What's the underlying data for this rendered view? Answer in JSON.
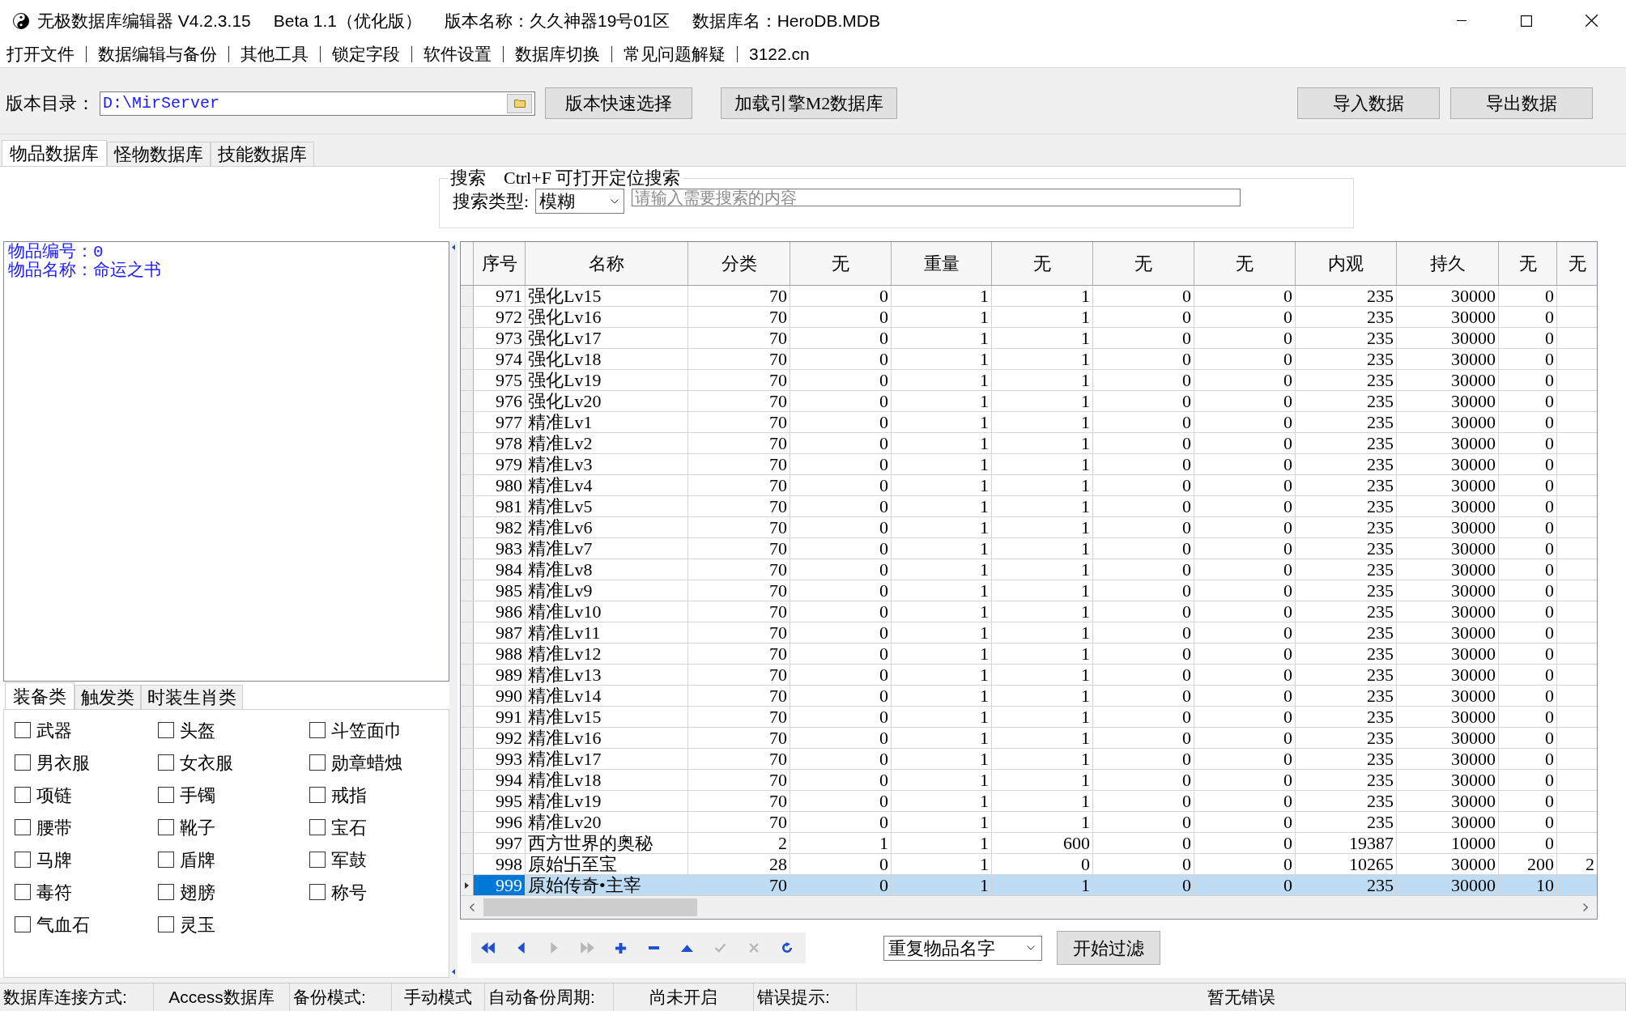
{
  "title_bar": {
    "texts": [
      "无极数据库编辑器 V4.2.3.15",
      "Beta 1.1（优化版）",
      "版本名称：久久神器19号01区",
      "数据库名：HeroDB.MDB"
    ]
  },
  "menu": [
    "打开文件",
    "数据编辑与备份",
    "其他工具",
    "锁定字段",
    "软件设置",
    "数据库切换",
    "常见问题解疑",
    "3122.cn"
  ],
  "toolbar": {
    "directory_label": "版本目录：",
    "directory_field": {
      "value": "D:\\MirServer"
    },
    "buttons": [
      "版本快速选择",
      "加载引擎M2数据库"
    ],
    "right_buttons": [
      "导入数据",
      "导出数据"
    ]
  },
  "tabs": [
    {
      "label": "物品数据库",
      "selected": true
    },
    {
      "label": "怪物数据库",
      "selected": false
    },
    {
      "label": "技能数据库",
      "selected": false
    }
  ],
  "search": {
    "title": "搜索",
    "hint": "Ctrl+F 可打开定位搜索",
    "type_label": "搜索类型:",
    "type_value": "模糊",
    "placeholder": "请输入需要搜索的内容"
  },
  "item_info": {
    "lines": [
      "物品编号：0",
      "物品名称：命运之书"
    ]
  },
  "category_tabs": [
    {
      "label": "装备类",
      "selected": true
    },
    {
      "label": "触发类",
      "selected": false
    },
    {
      "label": "时装生肖类",
      "selected": false
    }
  ],
  "categories": [
    {
      "label": "武器",
      "checked": false
    },
    {
      "label": "头盔",
      "checked": false
    },
    {
      "label": "斗笠面巾",
      "checked": false
    },
    {
      "label": "男衣服",
      "checked": false
    },
    {
      "label": "女衣服",
      "checked": false
    },
    {
      "label": "勋章蜡烛",
      "checked": false
    },
    {
      "label": "项链",
      "checked": false
    },
    {
      "label": "手镯",
      "checked": false
    },
    {
      "label": "戒指",
      "checked": false
    },
    {
      "label": "腰带",
      "checked": false
    },
    {
      "label": "靴子",
      "checked": false
    },
    {
      "label": "宝石",
      "checked": false
    },
    {
      "label": "马牌",
      "checked": false
    },
    {
      "label": "盾牌",
      "checked": false
    },
    {
      "label": "军鼓",
      "checked": false
    },
    {
      "label": "毒符",
      "checked": false
    },
    {
      "label": "翅膀",
      "checked": false
    },
    {
      "label": "称号",
      "checked": false
    },
    {
      "label": "气血石",
      "checked": false
    },
    {
      "label": "灵玉",
      "checked": false
    }
  ],
  "table": {
    "columns": [
      "序号",
      "名称",
      "分类",
      "无",
      "重量",
      "无",
      "无",
      "无",
      "内观",
      "持久",
      "无",
      "无"
    ],
    "rows": [
      {
        "cells": [
          "971",
          "强化Lv15",
          "70",
          "0",
          "1",
          "1",
          "0",
          "0",
          "235",
          "30000",
          "0"
        ],
        "selected": false
      },
      {
        "cells": [
          "972",
          "强化Lv16",
          "70",
          "0",
          "1",
          "1",
          "0",
          "0",
          "235",
          "30000",
          "0"
        ],
        "selected": false
      },
      {
        "cells": [
          "973",
          "强化Lv17",
          "70",
          "0",
          "1",
          "1",
          "0",
          "0",
          "235",
          "30000",
          "0"
        ],
        "selected": false
      },
      {
        "cells": [
          "974",
          "强化Lv18",
          "70",
          "0",
          "1",
          "1",
          "0",
          "0",
          "235",
          "30000",
          "0"
        ],
        "selected": false
      },
      {
        "cells": [
          "975",
          "强化Lv19",
          "70",
          "0",
          "1",
          "1",
          "0",
          "0",
          "235",
          "30000",
          "0"
        ],
        "selected": false
      },
      {
        "cells": [
          "976",
          "强化Lv20",
          "70",
          "0",
          "1",
          "1",
          "0",
          "0",
          "235",
          "30000",
          "0"
        ],
        "selected": false
      },
      {
        "cells": [
          "977",
          "精准Lv1",
          "70",
          "0",
          "1",
          "1",
          "0",
          "0",
          "235",
          "30000",
          "0"
        ],
        "selected": false
      },
      {
        "cells": [
          "978",
          "精准Lv2",
          "70",
          "0",
          "1",
          "1",
          "0",
          "0",
          "235",
          "30000",
          "0"
        ],
        "selected": false
      },
      {
        "cells": [
          "979",
          "精准Lv3",
          "70",
          "0",
          "1",
          "1",
          "0",
          "0",
          "235",
          "30000",
          "0"
        ],
        "selected": false
      },
      {
        "cells": [
          "980",
          "精准Lv4",
          "70",
          "0",
          "1",
          "1",
          "0",
          "0",
          "235",
          "30000",
          "0"
        ],
        "selected": false
      },
      {
        "cells": [
          "981",
          "精准Lv5",
          "70",
          "0",
          "1",
          "1",
          "0",
          "0",
          "235",
          "30000",
          "0"
        ],
        "selected": false
      },
      {
        "cells": [
          "982",
          "精准Lv6",
          "70",
          "0",
          "1",
          "1",
          "0",
          "0",
          "235",
          "30000",
          "0"
        ],
        "selected": false
      },
      {
        "cells": [
          "983",
          "精准Lv7",
          "70",
          "0",
          "1",
          "1",
          "0",
          "0",
          "235",
          "30000",
          "0"
        ],
        "selected": false
      },
      {
        "cells": [
          "984",
          "精准Lv8",
          "70",
          "0",
          "1",
          "1",
          "0",
          "0",
          "235",
          "30000",
          "0"
        ],
        "selected": false
      },
      {
        "cells": [
          "985",
          "精准Lv9",
          "70",
          "0",
          "1",
          "1",
          "0",
          "0",
          "235",
          "30000",
          "0"
        ],
        "selected": false
      },
      {
        "cells": [
          "986",
          "精准Lv10",
          "70",
          "0",
          "1",
          "1",
          "0",
          "0",
          "235",
          "30000",
          "0"
        ],
        "selected": false
      },
      {
        "cells": [
          "987",
          "精准Lv11",
          "70",
          "0",
          "1",
          "1",
          "0",
          "0",
          "235",
          "30000",
          "0"
        ],
        "selected": false
      },
      {
        "cells": [
          "988",
          "精准Lv12",
          "70",
          "0",
          "1",
          "1",
          "0",
          "0",
          "235",
          "30000",
          "0"
        ],
        "selected": false
      },
      {
        "cells": [
          "989",
          "精准Lv13",
          "70",
          "0",
          "1",
          "1",
          "0",
          "0",
          "235",
          "30000",
          "0"
        ],
        "selected": false
      },
      {
        "cells": [
          "990",
          "精准Lv14",
          "70",
          "0",
          "1",
          "1",
          "0",
          "0",
          "235",
          "30000",
          "0"
        ],
        "selected": false
      },
      {
        "cells": [
          "991",
          "精准Lv15",
          "70",
          "0",
          "1",
          "1",
          "0",
          "0",
          "235",
          "30000",
          "0"
        ],
        "selected": false
      },
      {
        "cells": [
          "992",
          "精准Lv16",
          "70",
          "0",
          "1",
          "1",
          "0",
          "0",
          "235",
          "30000",
          "0"
        ],
        "selected": false
      },
      {
        "cells": [
          "993",
          "精准Lv17",
          "70",
          "0",
          "1",
          "1",
          "0",
          "0",
          "235",
          "30000",
          "0"
        ],
        "selected": false
      },
      {
        "cells": [
          "994",
          "精准Lv18",
          "70",
          "0",
          "1",
          "1",
          "0",
          "0",
          "235",
          "30000",
          "0"
        ],
        "selected": false
      },
      {
        "cells": [
          "995",
          "精准Lv19",
          "70",
          "0",
          "1",
          "1",
          "0",
          "0",
          "235",
          "30000",
          "0"
        ],
        "selected": false
      },
      {
        "cells": [
          "996",
          "精准Lv20",
          "70",
          "0",
          "1",
          "1",
          "0",
          "0",
          "235",
          "30000",
          "0"
        ],
        "selected": false
      },
      {
        "cells": [
          "997",
          "西方世界的奥秘",
          "2",
          "1",
          "1",
          "600",
          "0",
          "0",
          "19387",
          "10000",
          "0"
        ],
        "selected": false
      },
      {
        "cells": [
          "998",
          "原始卐至宝",
          "28",
          "0",
          "1",
          "0",
          "0",
          "0",
          "10265",
          "30000",
          "200",
          "2"
        ],
        "selected": false
      },
      {
        "cells": [
          "999",
          "原始传奇•主宰",
          "70",
          "0",
          "1",
          "1",
          "0",
          "0",
          "235",
          "30000",
          "10"
        ],
        "selected": true
      }
    ]
  },
  "navigator": [
    {
      "kind": "first",
      "disabled": false
    },
    {
      "kind": "prior",
      "disabled": false
    },
    {
      "kind": "next",
      "disabled": true
    },
    {
      "kind": "last",
      "disabled": true
    },
    {
      "kind": "insert",
      "disabled": false
    },
    {
      "kind": "delete",
      "disabled": false
    },
    {
      "kind": "edit",
      "disabled": false
    },
    {
      "kind": "post",
      "disabled": true
    },
    {
      "kind": "cancel",
      "disabled": true
    },
    {
      "kind": "refresh",
      "disabled": false
    }
  ],
  "filter": {
    "value": "重复物品名字",
    "button": "开始过滤"
  },
  "status_bar": [
    {
      "label": "数据库连接方式:",
      "value": "Access数据库"
    },
    {
      "label": "备份模式:",
      "value": "手动模式"
    },
    {
      "label": "自动备份周期:",
      "value": "尚未开启"
    },
    {
      "label": "错误提示:",
      "value": "暂无错误"
    }
  ]
}
